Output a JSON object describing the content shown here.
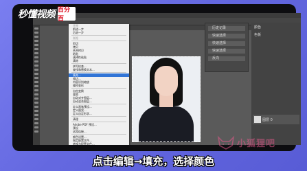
{
  "logo": {
    "brand": "秒懂视频",
    "badge": "百分百"
  },
  "caption": "点击编辑→填充，选择颜色",
  "watermark": {
    "text": "小狐狸吧"
  },
  "edit_menu": {
    "items": [
      {
        "label": "还原",
        "state": "dis"
      },
      {
        "label": "前进一步",
        "state": ""
      },
      {
        "label": "后退一步",
        "state": ""
      },
      {
        "sep": true
      },
      {
        "label": "渐隐",
        "state": "dis"
      },
      {
        "sep": true
      },
      {
        "label": "剪切",
        "state": ""
      },
      {
        "label": "拷贝",
        "state": ""
      },
      {
        "label": "合并拷贝",
        "state": ""
      },
      {
        "label": "粘贴",
        "state": ""
      },
      {
        "label": "选择性粘贴",
        "state": ""
      },
      {
        "label": "清除",
        "state": ""
      },
      {
        "sep": true
      },
      {
        "label": "拼写检查...",
        "state": ""
      },
      {
        "label": "查找和替换文本...",
        "state": ""
      },
      {
        "sep": true
      },
      {
        "label": "填充...",
        "state": "hl"
      },
      {
        "label": "描边...",
        "state": ""
      },
      {
        "label": "内容识别缩放",
        "state": ""
      },
      {
        "label": "操控变形",
        "state": ""
      },
      {
        "sep": true
      },
      {
        "label": "自由变换",
        "state": ""
      },
      {
        "label": "变换",
        "state": ""
      },
      {
        "label": "自动对齐图层...",
        "state": ""
      },
      {
        "label": "自动混合图层...",
        "state": ""
      },
      {
        "sep": true
      },
      {
        "label": "定义画笔预设...",
        "state": ""
      },
      {
        "label": "定义图案...",
        "state": ""
      },
      {
        "label": "定义自定形状...",
        "state": ""
      },
      {
        "sep": true
      },
      {
        "label": "清理",
        "state": ""
      },
      {
        "sep": true
      },
      {
        "label": "Adobe PDF 预设...",
        "state": ""
      },
      {
        "label": "预设",
        "state": ""
      },
      {
        "label": "远程连接...",
        "state": ""
      },
      {
        "sep": true
      },
      {
        "label": "颜色设置...",
        "state": ""
      },
      {
        "label": "指定配置文件...",
        "state": ""
      },
      {
        "label": "转换为配置文件...",
        "state": ""
      },
      {
        "sep": true
      },
      {
        "label": "键盘快捷键...",
        "state": ""
      },
      {
        "label": "菜单...",
        "state": ""
      },
      {
        "label": "首选项",
        "state": ""
      }
    ]
  },
  "history_panel": {
    "rows": [
      "历史记录",
      "快速选择",
      "快速选择",
      "快速选择",
      "反向"
    ]
  },
  "right_panel": {
    "rows": [
      "颜色",
      "色板"
    ],
    "layer_label": "图层 0"
  },
  "colors": {
    "accent_highlight": "#3174d6",
    "background": "#6f73e6"
  }
}
